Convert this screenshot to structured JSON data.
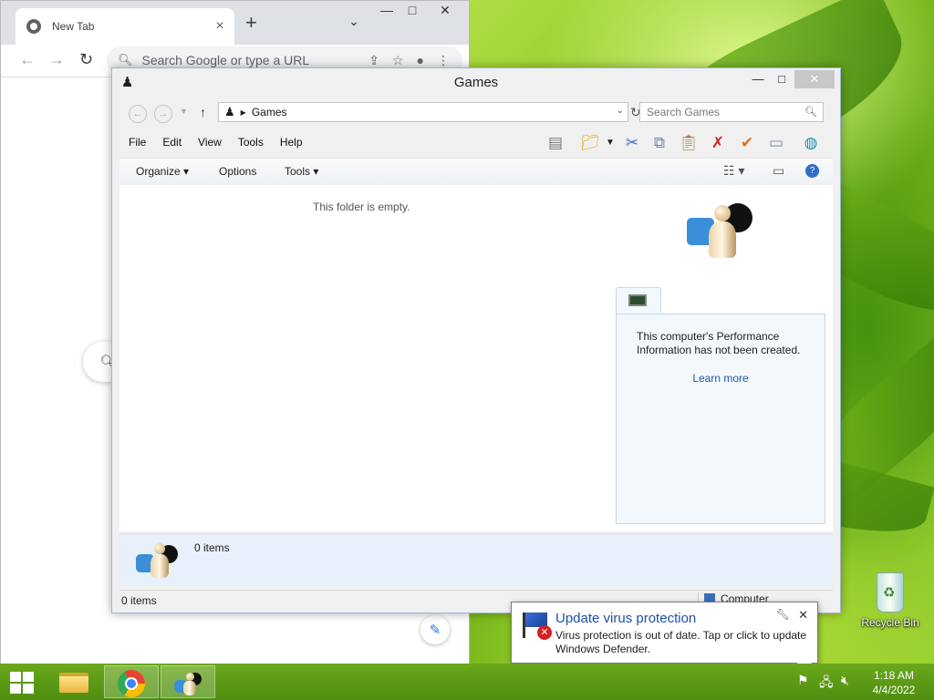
{
  "chrome": {
    "tab_title": "New Tab",
    "omnibox_placeholder": "Search Google or type a URL"
  },
  "explorer": {
    "window_title": "Games",
    "address_crumb": "Games",
    "search_placeholder": "Search Games",
    "menu": [
      "File",
      "Edit",
      "View",
      "Tools",
      "Help"
    ],
    "commands": {
      "organize": "Organize",
      "options": "Options",
      "tools": "Tools"
    },
    "empty_message": "This folder is empty.",
    "perf_text": "This computer's Performance Information has not been created.",
    "learn_more": "Learn more",
    "details_count": "0 items",
    "status_count": "0 items",
    "status_zone": "Computer"
  },
  "balloon": {
    "title": "Update virus protection",
    "body": "Virus protection is out of date. Tap or click to update Windows Defender."
  },
  "desktop": {
    "recycle_bin": "Recycle Bin"
  },
  "clock": {
    "time": "1:18 AM",
    "date": "4/4/2022"
  },
  "icons": [
    "windows-start-icon",
    "file-explorer-icon",
    "chrome-icon",
    "games-icon",
    "action-center-flag-icon",
    "network-icon",
    "volume-muted-icon"
  ]
}
